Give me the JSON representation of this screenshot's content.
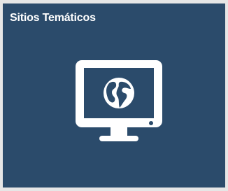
{
  "tile": {
    "title": "Sitios Temáticos",
    "icon": "monitor-globe-icon",
    "background_color": "#2b4b6b",
    "icon_color": "#ffffff"
  }
}
